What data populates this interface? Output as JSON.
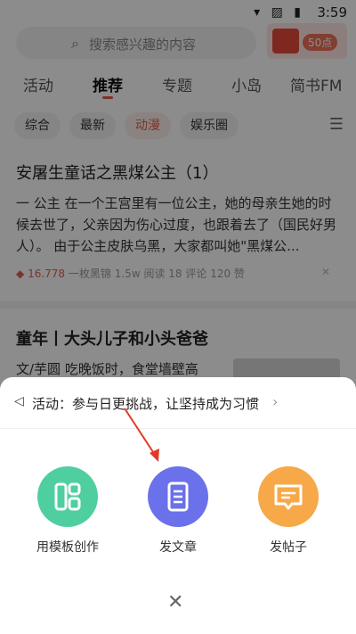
{
  "status_bar": {
    "time": "3:59"
  },
  "search": {
    "placeholder": "搜索感兴趣的内容"
  },
  "red_packet": {
    "points": "50点"
  },
  "tabs": [
    {
      "label": "活动"
    },
    {
      "label": "推荐",
      "active": true
    },
    {
      "label": "专题"
    },
    {
      "label": "小岛"
    },
    {
      "label": "简书FM"
    }
  ],
  "chips": [
    {
      "label": "综合"
    },
    {
      "label": "最新"
    },
    {
      "label": "动漫",
      "active": true
    },
    {
      "label": "娱乐圈"
    }
  ],
  "articles": [
    {
      "title": "安屠生童话之黑煤公主（1）",
      "body": "一 公主 在一个王宫里有一位公主，她的母亲生她的时候去世了，父亲因为伤心过度，也跟着去了（国民好男人）。 由于公主皮肤乌黑，大家都叫她\"黑煤公...",
      "diamond": "16.778",
      "author": "一枚黑锦",
      "reads": "1.5w 阅读",
      "comments": "18 评论",
      "likes": "120 赞"
    },
    {
      "title": "童年丨大头儿子和小头爸爸",
      "body": "文/芋圆 吃晚饭时，食堂墙壁高"
    }
  ],
  "sheet": {
    "activity_text": "活动：参与日更挑战，让坚持成为习惯",
    "actions": [
      {
        "label": "用模板创作",
        "icon": "template-icon",
        "color": "#4fcfa0"
      },
      {
        "label": "发文章",
        "icon": "document-icon",
        "color": "#6b71ea"
      },
      {
        "label": "发帖子",
        "icon": "post-icon",
        "color": "#f7a94a"
      }
    ]
  },
  "annotation_color": "#e23a2a"
}
